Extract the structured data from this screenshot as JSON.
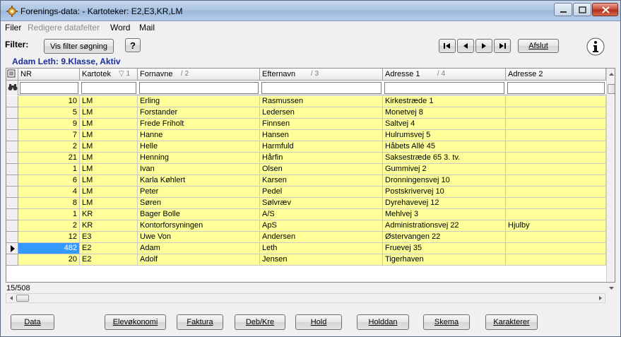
{
  "window": {
    "title": "Forenings-data: - Kartoteker: E2,E3,KR,LM"
  },
  "menu": [
    {
      "label": "Filer",
      "disabled": false
    },
    {
      "label": "Redigere datafelter",
      "disabled": true
    },
    {
      "label": "Word",
      "disabled": false
    },
    {
      "label": "Mail",
      "disabled": false
    }
  ],
  "toolbar": {
    "filter_label": "Filter:",
    "vis_filter_button": "Vis filter søgning",
    "help_button": "?",
    "afslut_button": "Afslut",
    "nav_icons": [
      "first-record-icon",
      "previous-record-icon",
      "next-record-icon",
      "last-record-icon"
    ]
  },
  "record_label": "Adam Leth: 9.Klasse, Aktiv",
  "grid": {
    "columns": [
      {
        "label": "NR",
        "sort": ""
      },
      {
        "label": "Kartotek",
        "sort": "1"
      },
      {
        "label": "Fornavne",
        "sort": "2"
      },
      {
        "label": "Efternavn",
        "sort": "3"
      },
      {
        "label": "Adresse 1",
        "sort": "4"
      },
      {
        "label": "Adresse 2",
        "sort": ""
      }
    ],
    "rows": [
      {
        "nr": "10",
        "kartotek": "LM",
        "fornavne": "Erling",
        "efternavn": "Rasmussen",
        "adresse1": "Kirkestræde 1",
        "adresse2": ""
      },
      {
        "nr": "5",
        "kartotek": "LM",
        "fornavne": "Forstander",
        "efternavn": "Ledersen",
        "adresse1": "Monetvej 8",
        "adresse2": ""
      },
      {
        "nr": "9",
        "kartotek": "LM",
        "fornavne": "Frede Friholt",
        "efternavn": "Finnsen",
        "adresse1": "Saltvej 4",
        "adresse2": ""
      },
      {
        "nr": "7",
        "kartotek": "LM",
        "fornavne": "Hanne",
        "efternavn": "Hansen",
        "adresse1": "Hulrumsvej 5",
        "adresse2": ""
      },
      {
        "nr": "2",
        "kartotek": "LM",
        "fornavne": "Helle",
        "efternavn": "Harmfuld",
        "adresse1": "Håbets Allé 45",
        "adresse2": ""
      },
      {
        "nr": "21",
        "kartotek": "LM",
        "fornavne": "Henning",
        "efternavn": "Hårfin",
        "adresse1": "Saksestræde 65 3. tv.",
        "adresse2": ""
      },
      {
        "nr": "1",
        "kartotek": "LM",
        "fornavne": "Ivan",
        "efternavn": "Olsen",
        "adresse1": "Gummivej 2",
        "adresse2": ""
      },
      {
        "nr": "6",
        "kartotek": "LM",
        "fornavne": "Karla Køhlert",
        "efternavn": "Karsen",
        "adresse1": "Dronningensvej 10",
        "adresse2": ""
      },
      {
        "nr": "4",
        "kartotek": "LM",
        "fornavne": "Peter",
        "efternavn": "Pedel",
        "adresse1": "Postskrivervej 10",
        "adresse2": ""
      },
      {
        "nr": "8",
        "kartotek": "LM",
        "fornavne": "Søren",
        "efternavn": "Sølvræv",
        "adresse1": "Dyrehavevej 12",
        "adresse2": ""
      },
      {
        "nr": "1",
        "kartotek": "KR",
        "fornavne": "Bager Bolle",
        "efternavn": "A/S",
        "adresse1": "Mehlvej 3",
        "adresse2": ""
      },
      {
        "nr": "2",
        "kartotek": "KR",
        "fornavne": "Kontorforsyningen",
        "efternavn": "ApS",
        "adresse1": "Administrationsvej 22",
        "adresse2": "Hjulby"
      },
      {
        "nr": "12",
        "kartotek": "E3",
        "fornavne": "Uwe Von",
        "efternavn": "Andersen",
        "adresse1": "Østervangen 22",
        "adresse2": ""
      },
      {
        "nr": "482",
        "kartotek": "E2",
        "fornavne": "Adam",
        "efternavn": "Leth",
        "adresse1": "Fruevej 35",
        "adresse2": "",
        "selected": true
      },
      {
        "nr": "20",
        "kartotek": "E2",
        "fornavne": "Adolf",
        "efternavn": "Jensen",
        "adresse1": "Tigerhaven",
        "adresse2": ""
      }
    ]
  },
  "status": {
    "record_count": "15/508"
  },
  "bottom_buttons": [
    "Data",
    "Elevøkonomi",
    "Faktura",
    "Deb/Kre",
    "Hold",
    "Holddan",
    "Skema",
    "Karakterer"
  ],
  "colors": {
    "row_background": "#ffff99",
    "selected_cell": "#3399ff",
    "record_label": "#1a2f9c"
  }
}
